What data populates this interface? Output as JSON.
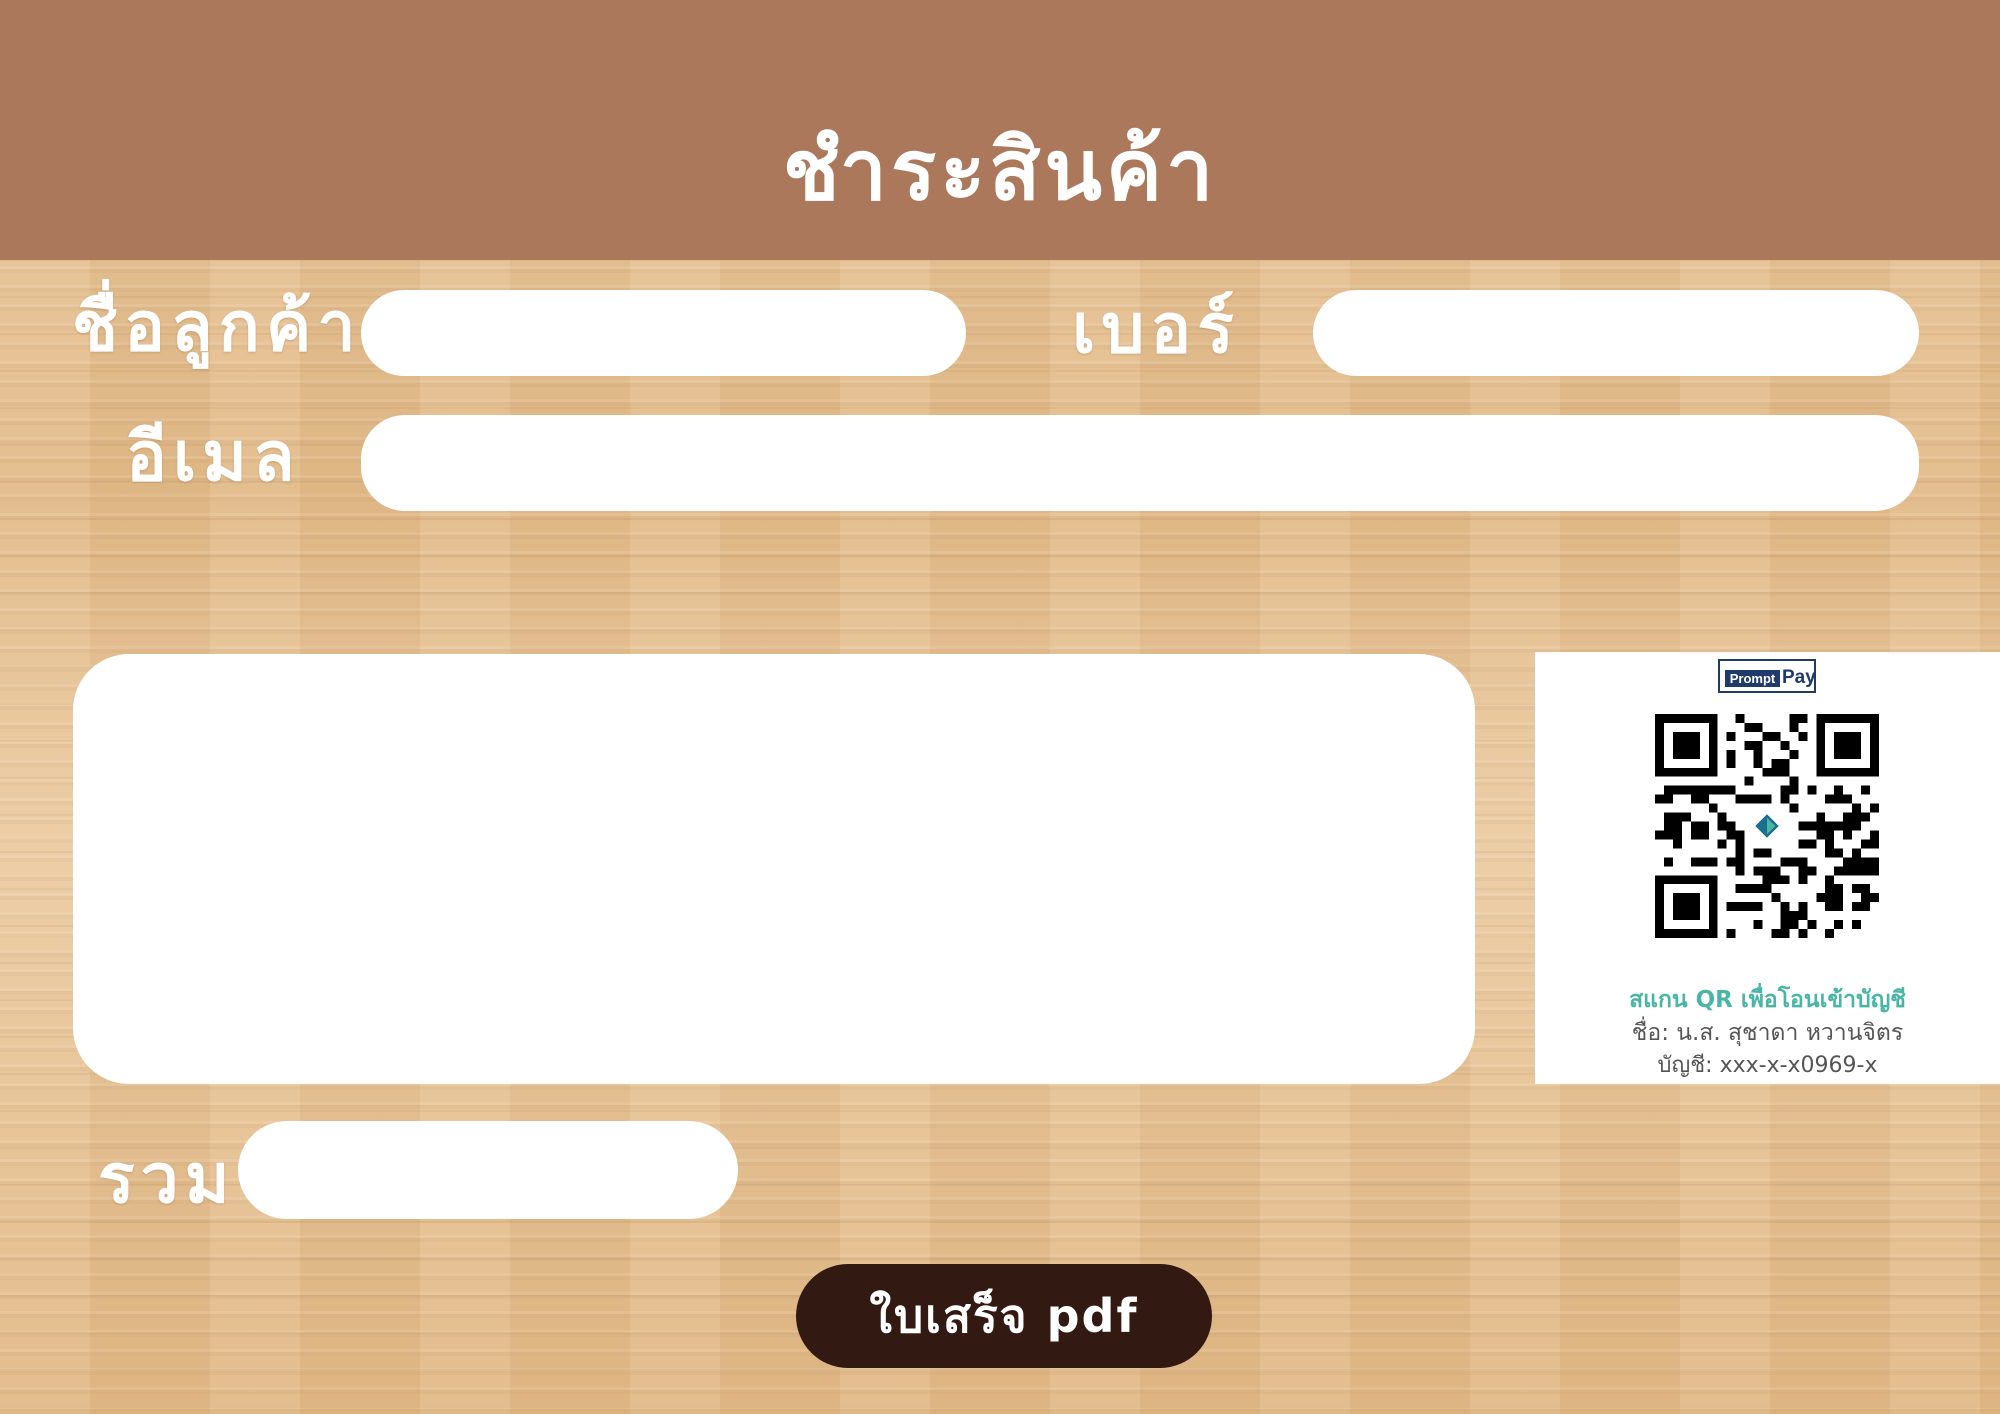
{
  "header": {
    "title": "ชำระสินค้า"
  },
  "form": {
    "customer_name_label": "ชื่อลูกค้า",
    "customer_name_value": "",
    "phone_label": "เบอร์",
    "phone_value": "",
    "email_label": "อีเมล",
    "email_value": "",
    "order_details_value": "",
    "total_label": "รวม",
    "total_value": ""
  },
  "payment": {
    "logo_text_box": "Prompt",
    "logo_text_word": "Pay",
    "scan_text": "สแกน QR เพื่อโอนเข้าบัญชี",
    "account_name": "ชื่อ: น.ส. สุชาดา หวานจิตร",
    "account_number": "บัญชี: xxx-x-x0969-x"
  },
  "actions": {
    "receipt_button_label": "ใบเสร็จ pdf"
  },
  "colors": {
    "header": "#ab785b",
    "button": "#321a12",
    "wood": "#e6c193",
    "scan_text": "#4ab5a5"
  },
  "icons": {
    "qr": "qr-code-icon",
    "logo": "promptpay-logo-icon"
  }
}
